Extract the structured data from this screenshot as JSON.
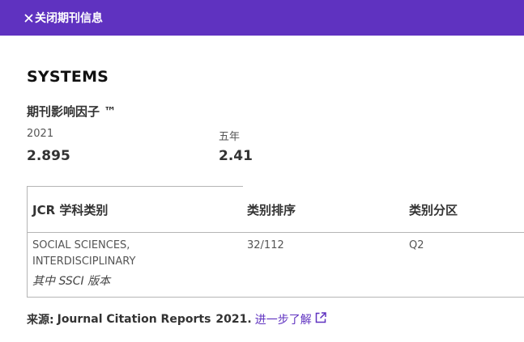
{
  "header": {
    "close_label": "关闭期刊信息"
  },
  "journal": {
    "title": "SYSTEMS"
  },
  "impact": {
    "heading": "期刊影响因子 ™",
    "year_label": "2021",
    "year_value": "2.895",
    "five_year_label": "五年",
    "five_year_value": "2.41"
  },
  "jcr_table": {
    "headers": [
      "JCR 学科类别",
      "类别排序",
      "类别分区"
    ],
    "rows": [
      {
        "category": "SOCIAL SCIENCES, INTERDISCIPLINARY",
        "edition": "其中 SSCI 版本",
        "rank": "32/112",
        "quartile": "Q2"
      }
    ]
  },
  "source": {
    "prefix": "来源:",
    "name": "Journal Citation Reports",
    "year": "2021.",
    "link_label": "进一步了解"
  },
  "colors": {
    "accent": "#5f32c0"
  }
}
